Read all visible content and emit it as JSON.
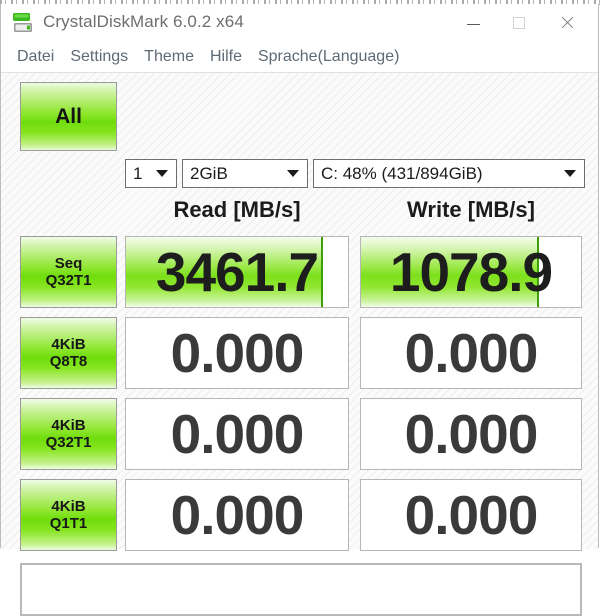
{
  "window": {
    "title": "CrystalDiskMark 6.0.2 x64",
    "icon": "disk-drive-icon",
    "minimize_label": "Minimize",
    "maximize_label": "Maximize",
    "close_label": "Close"
  },
  "menubar": {
    "items": [
      {
        "label": "Datei"
      },
      {
        "label": "Settings"
      },
      {
        "label": "Theme"
      },
      {
        "label": "Hilfe"
      },
      {
        "label": "Sprache(Language)"
      }
    ]
  },
  "toolbar": {
    "all_button": "All",
    "count_value": "1",
    "size_value": "2GiB",
    "drive_value": "C: 48% (431/894GiB)"
  },
  "columns": {
    "read_header": "Read [MB/s]",
    "write_header": "Write [MB/s]"
  },
  "rows": [
    {
      "label_line1": "Seq",
      "label_line2": "Q32T1",
      "read": "3461.7",
      "write": "1078.9",
      "read_fill_pct": 88,
      "write_fill_pct": 80
    },
    {
      "label_line1": "4KiB",
      "label_line2": "Q8T8",
      "read": "0.000",
      "write": "0.000",
      "read_fill_pct": 0,
      "write_fill_pct": 0
    },
    {
      "label_line1": "4KiB",
      "label_line2": "Q32T1",
      "read": "0.000",
      "write": "0.000",
      "read_fill_pct": 0,
      "write_fill_pct": 0
    },
    {
      "label_line1": "4KiB",
      "label_line2": "Q1T1",
      "read": "0.000",
      "write": "0.000",
      "read_fill_pct": 0,
      "write_fill_pct": 0
    }
  ],
  "status": {
    "text": ""
  },
  "colors": {
    "accent_green": "#6fdd0c",
    "bar_edge": "#3f9e06",
    "menu_text": "#5e6a75",
    "title_text": "#6e6e6e"
  }
}
